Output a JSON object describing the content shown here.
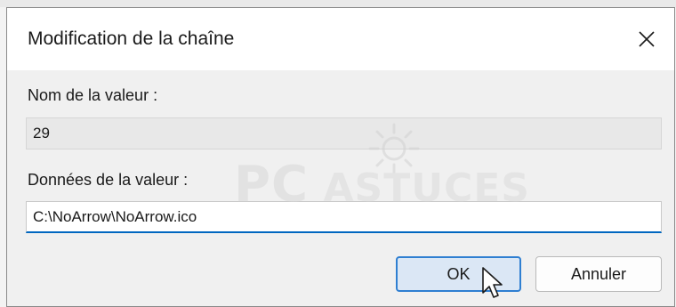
{
  "dialog": {
    "title": "Modification de la chaîne",
    "close_icon": "close-icon"
  },
  "value_name": {
    "label": "Nom de la valeur :",
    "value": "29"
  },
  "value_data": {
    "label": "Données de la valeur :",
    "value": "C:\\NoArrow\\NoArrow.ico"
  },
  "buttons": {
    "ok_label": "OK",
    "cancel_label": "Annuler"
  },
  "watermark": {
    "pc": "PC",
    "brand": "ASTUCES"
  },
  "colors": {
    "accent": "#0067c0",
    "ok_border": "#2f7fd1",
    "ok_fill": "#dbe7f5"
  }
}
